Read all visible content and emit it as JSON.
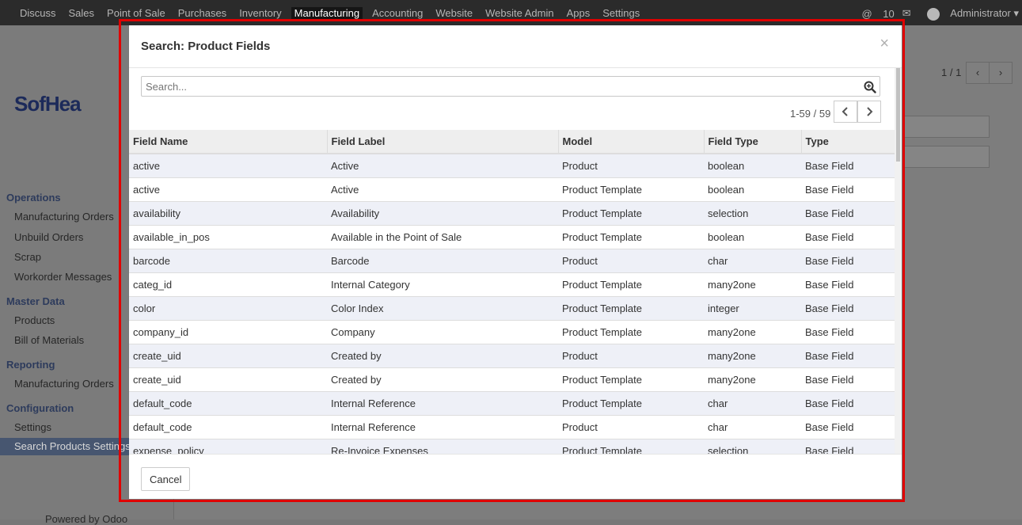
{
  "topbar": {
    "menu": [
      "Discuss",
      "Sales",
      "Point of Sale",
      "Purchases",
      "Inventory",
      "Manufacturing",
      "Accounting",
      "Website",
      "Website Admin",
      "Apps",
      "Settings"
    ],
    "active_menu": "Manufacturing",
    "notifications_count": "10",
    "user": "Administrator"
  },
  "background": {
    "logo_text": "SofHea",
    "pager": "1 / 1",
    "sidebar": [
      {
        "section": "Operations",
        "items": [
          "Manufacturing Orders",
          "Unbuild Orders",
          "Scrap",
          "Workorder Messages"
        ]
      },
      {
        "section": "Master Data",
        "items": [
          "Products",
          "Bill of Materials"
        ]
      },
      {
        "section": "Reporting",
        "items": [
          "Manufacturing Orders"
        ]
      },
      {
        "section": "Configuration",
        "items": [
          "Settings",
          "Search Products Settings"
        ]
      }
    ],
    "powered_by": "Powered by Odoo"
  },
  "modal": {
    "title": "Search: Product Fields",
    "close": "×",
    "search_placeholder": "Search...",
    "pager": "1-59 / 59",
    "columns": [
      "Field Name",
      "Field Label",
      "Model",
      "Field Type",
      "Type"
    ],
    "rows": [
      [
        "active",
        "Active",
        "Product",
        "boolean",
        "Base Field"
      ],
      [
        "active",
        "Active",
        "Product Template",
        "boolean",
        "Base Field"
      ],
      [
        "availability",
        "Availability",
        "Product Template",
        "selection",
        "Base Field"
      ],
      [
        "available_in_pos",
        "Available in the Point of Sale",
        "Product Template",
        "boolean",
        "Base Field"
      ],
      [
        "barcode",
        "Barcode",
        "Product",
        "char",
        "Base Field"
      ],
      [
        "categ_id",
        "Internal Category",
        "Product Template",
        "many2one",
        "Base Field"
      ],
      [
        "color",
        "Color Index",
        "Product Template",
        "integer",
        "Base Field"
      ],
      [
        "company_id",
        "Company",
        "Product Template",
        "many2one",
        "Base Field"
      ],
      [
        "create_uid",
        "Created by",
        "Product",
        "many2one",
        "Base Field"
      ],
      [
        "create_uid",
        "Created by",
        "Product Template",
        "many2one",
        "Base Field"
      ],
      [
        "default_code",
        "Internal Reference",
        "Product Template",
        "char",
        "Base Field"
      ],
      [
        "default_code",
        "Internal Reference",
        "Product",
        "char",
        "Base Field"
      ],
      [
        "expense_policy",
        "Re-Invoice Expenses",
        "Product Template",
        "selection",
        "Base Field"
      ]
    ],
    "cancel_label": "Cancel"
  }
}
